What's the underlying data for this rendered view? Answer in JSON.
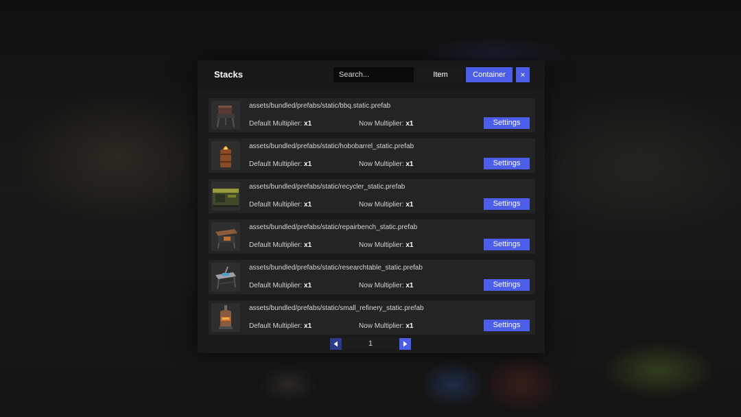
{
  "header": {
    "title": "Stacks",
    "search_placeholder": "Search...",
    "tabs": [
      {
        "label": "Item",
        "active": false
      },
      {
        "label": "Container",
        "active": true
      }
    ],
    "close_icon": "×"
  },
  "rows": [
    {
      "icon": "bbq-icon",
      "path": "assets/bundled/prefabs/static/bbq.static.prefab",
      "default_label": "Default Multiplier:",
      "default_value": "x1",
      "now_label": "Now Multiplier:",
      "now_value": "x1",
      "button": "Settings"
    },
    {
      "icon": "hobobarrel-icon",
      "path": "assets/bundled/prefabs/static/hobobarrel_static.prefab",
      "default_label": "Default Multiplier:",
      "default_value": "x1",
      "now_label": "Now Multiplier:",
      "now_value": "x1",
      "button": "Settings"
    },
    {
      "icon": "recycler-icon",
      "path": "assets/bundled/prefabs/static/recycler_static.prefab",
      "default_label": "Default Multiplier:",
      "default_value": "x1",
      "now_label": "Now Multiplier:",
      "now_value": "x1",
      "button": "Settings"
    },
    {
      "icon": "repairbench-icon",
      "path": "assets/bundled/prefabs/static/repairbench_static.prefab",
      "default_label": "Default Multiplier:",
      "default_value": "x1",
      "now_label": "Now Multiplier:",
      "now_value": "x1",
      "button": "Settings"
    },
    {
      "icon": "researchtable-icon",
      "path": "assets/bundled/prefabs/static/researchtable_static.prefab",
      "default_label": "Default Multiplier:",
      "default_value": "x1",
      "now_label": "Now Multiplier:",
      "now_value": "x1",
      "button": "Settings"
    },
    {
      "icon": "small-refinery-icon",
      "path": "assets/bundled/prefabs/static/small_refinery_static.prefab",
      "default_label": "Default Multiplier:",
      "default_value": "x1",
      "now_label": "Now Multiplier:",
      "now_value": "x1",
      "button": "Settings"
    }
  ],
  "pagination": {
    "page": "1",
    "prev_icon": "triangle-left-icon",
    "next_icon": "triangle-right-icon"
  },
  "colors": {
    "accent": "#4c5ee8",
    "panel": "#1a1a1a",
    "row": "#242424"
  }
}
